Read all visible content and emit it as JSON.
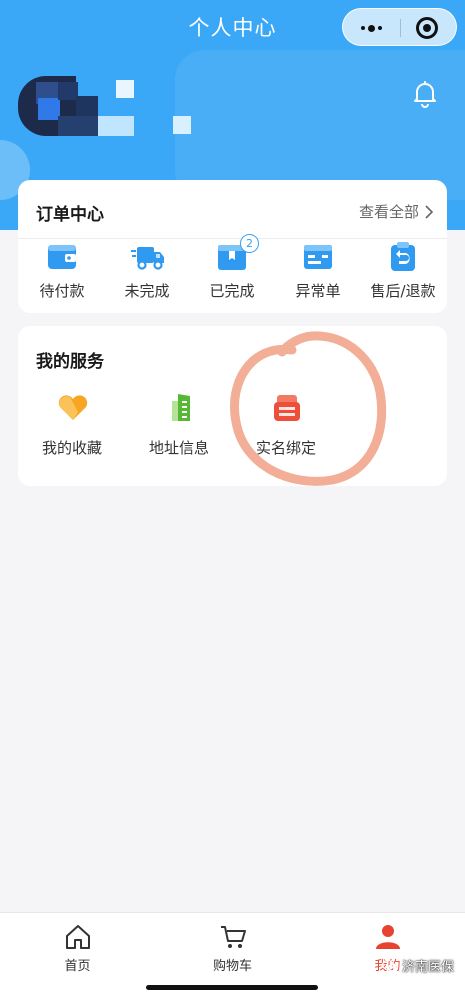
{
  "nav": {
    "title": "个人中心"
  },
  "orders": {
    "title": "订单中心",
    "view_all": "查看全部",
    "items": [
      {
        "label": "待付款",
        "icon": "wallet-icon"
      },
      {
        "label": "未完成",
        "icon": "delivery-truck-icon"
      },
      {
        "label": "已完成",
        "icon": "package-box-icon",
        "badge": "2"
      },
      {
        "label": "异常单",
        "icon": "card-icon"
      },
      {
        "label": "售后/退款",
        "icon": "return-clipboard-icon"
      }
    ]
  },
  "services": {
    "title": "我的服务",
    "items": [
      {
        "label": "我的收藏",
        "icon": "heart-icon"
      },
      {
        "label": "地址信息",
        "icon": "building-icon"
      },
      {
        "label": "实名绑定",
        "icon": "id-printer-icon"
      }
    ]
  },
  "tabbar": {
    "items": [
      {
        "label": "首页",
        "icon": "home-icon"
      },
      {
        "label": "购物车",
        "icon": "cart-icon"
      },
      {
        "label": "我的",
        "icon": "person-icon",
        "active": true
      }
    ]
  },
  "watermark": {
    "text": "济南医保",
    "icon": "wechat-icon"
  },
  "colors": {
    "header_blue": "#3aa8f6",
    "icon_blue": "#2f9af0",
    "active_red": "#e8432f",
    "annotation": "#f2a58c"
  }
}
